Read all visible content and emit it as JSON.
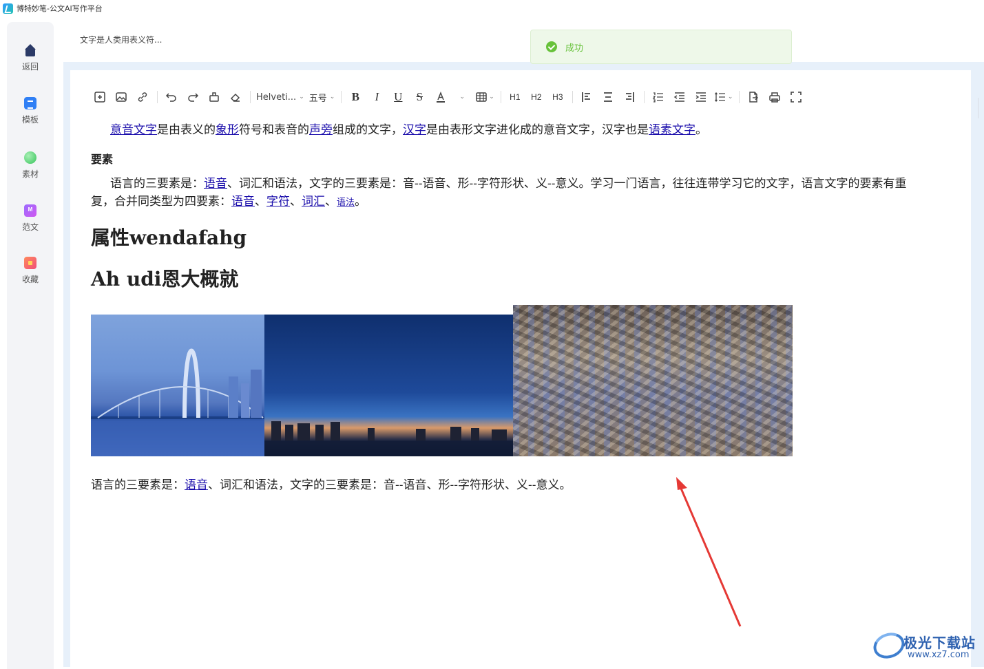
{
  "window": {
    "title": "博特妙笔-公文AI写作平台"
  },
  "sidebar": {
    "items": [
      {
        "label": "返回",
        "icon": "home-icon"
      },
      {
        "label": "模板",
        "icon": "template-icon"
      },
      {
        "label": "素材",
        "icon": "material-icon"
      },
      {
        "label": "范文",
        "icon": "sample-essay-icon"
      },
      {
        "label": "收藏",
        "icon": "favorites-icon"
      }
    ]
  },
  "document": {
    "tab_title": "文字是人类用表义符..."
  },
  "toast": {
    "message": "成功",
    "color": "#67c23a"
  },
  "toolbar": {
    "font_family": "Helveti...",
    "font_size": "五号",
    "h1": "H1",
    "h2": "H2",
    "h3": "H3"
  },
  "content": {
    "p1": {
      "l1": "意音文字",
      "t1": "是由表义的",
      "l2": "象形",
      "t2": "符号和表音的",
      "l3": "声旁",
      "t3": "组成的文字，",
      "l4": "汉字",
      "t4": "是由表形文字进化成的意音文字，汉字也是",
      "l5": "语素文字",
      "t5": "。"
    },
    "heading_elements": "要素",
    "p2": {
      "t1": "语言的三要素是：",
      "l1": "语音",
      "t2": "、词汇和语法，文字的三要素是：音--语音、形--字符形状、义--意义。学习一门语言，往往连带学习它的文字，语言文字的要素有重复，合并同类型为四要素：",
      "l2": "语音",
      "s1": "、",
      "l3": "字符",
      "s2": "、",
      "l4": "词汇",
      "s3": "、",
      "l5": "语法",
      "t3": "。"
    },
    "heading_attr": "属性wendafahg",
    "heading_ah": "Ah udi恩大概就",
    "p3": {
      "t1": "语言的三要素是：",
      "l1": "语音",
      "t2": "、词汇和语法，文字的三要素是：音--语音、形--字符形状、义--意义。"
    }
  },
  "watermark": {
    "line1": "极光下载站",
    "line2": "www.xz7.com"
  }
}
